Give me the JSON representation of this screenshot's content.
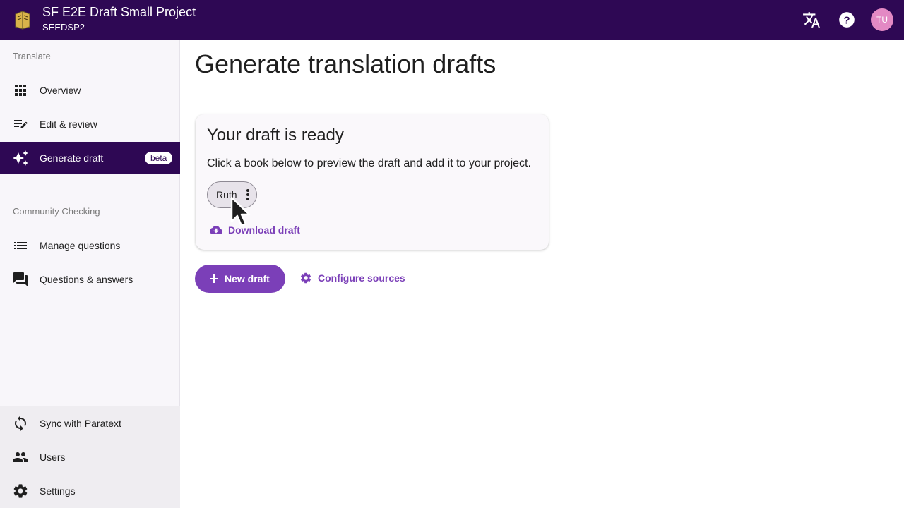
{
  "header": {
    "project_title": "SF E2E Draft Small Project",
    "project_code": "SEEDSP2",
    "avatar_initials": "TU",
    "avatar_color": "#e389c4",
    "icons": [
      "translate-icon",
      "help-icon"
    ]
  },
  "sidebar": {
    "translate_section": "Translate",
    "translate_items": [
      {
        "label": "Overview",
        "icon": "apps-grid-icon"
      },
      {
        "label": "Edit & review",
        "icon": "edit-notes-icon"
      },
      {
        "label": "Generate draft",
        "icon": "sparkle-icon",
        "active": true,
        "badge": "beta"
      }
    ],
    "community_section": "Community Checking",
    "community_items": [
      {
        "label": "Manage questions",
        "icon": "list-icon"
      },
      {
        "label": "Questions & answers",
        "icon": "forum-icon"
      }
    ],
    "bottom_items": [
      {
        "label": "Sync with Paratext",
        "icon": "sync-icon"
      },
      {
        "label": "Users",
        "icon": "people-icon"
      },
      {
        "label": "Settings",
        "icon": "gear-icon"
      }
    ]
  },
  "main": {
    "title": "Generate translation drafts",
    "card": {
      "title": "Your draft is ready",
      "text": "Click a book below to preview the draft and add it to your project.",
      "book_chip": "Ruth",
      "download_label": "Download draft"
    },
    "new_draft_label": "New draft",
    "configure_label": "Configure sources"
  },
  "colors": {
    "brand": "#2e0854",
    "accent": "#7b3fb8"
  }
}
